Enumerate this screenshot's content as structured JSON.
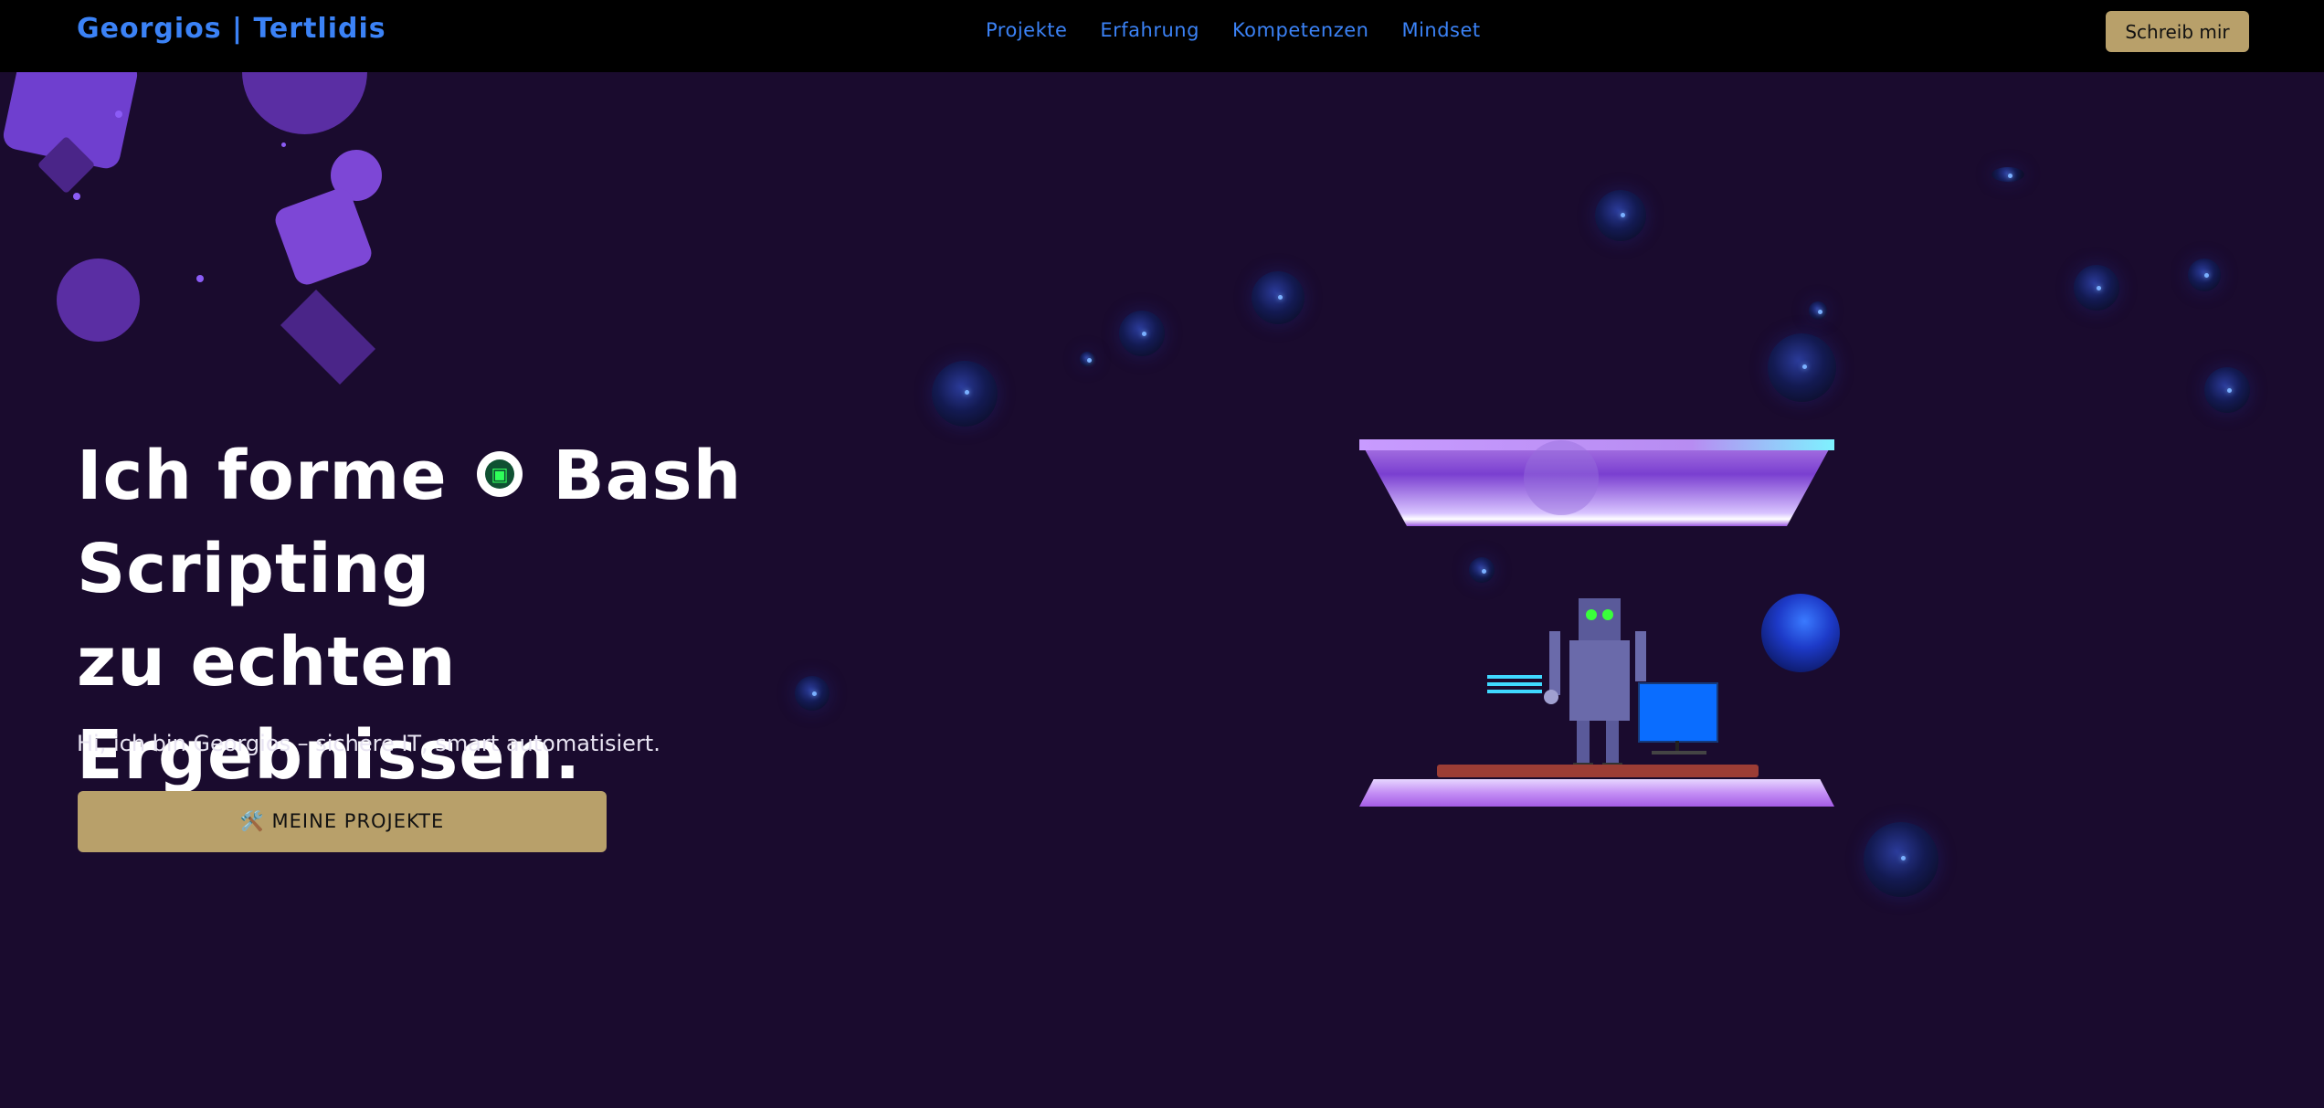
{
  "nav": {
    "brand": "Georgios | Tertlidis",
    "links": [
      "Projekte",
      "Erfahrung",
      "Kompetenzen",
      "Mindset"
    ],
    "cta": "Schreib mir"
  },
  "hero": {
    "title_part1": "Ich forme",
    "tech": "Bash Scripting",
    "tech_icon": "terminal-icon",
    "title_part2": "zu echten",
    "title_part3": "Ergebnissen.",
    "subtitle": "Hi, ich bin Georgios – sichere IT, smart automatisiert.",
    "cta": "🛠️ MEINE PROJEKTE"
  },
  "colors": {
    "background": "#1a0b2e",
    "nav_background": "#000000",
    "accent_blue": "#3b82f6",
    "gold": "#b8a06a"
  }
}
